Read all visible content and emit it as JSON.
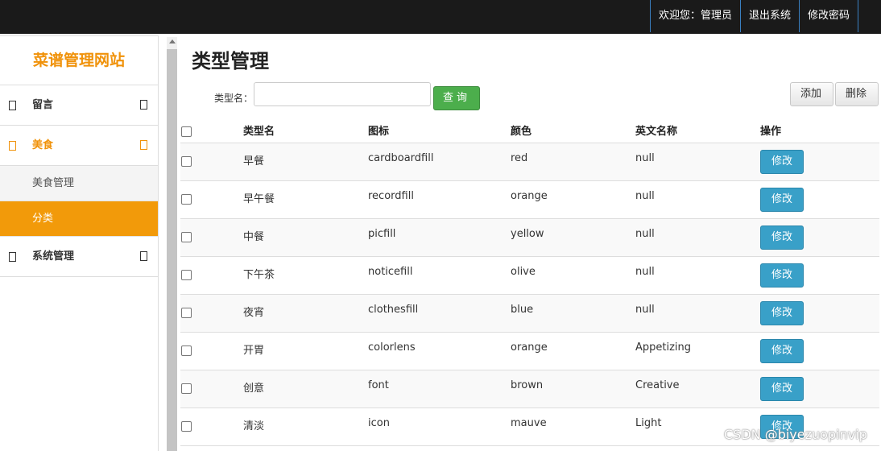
{
  "topbar": {
    "items": [
      "欢迎您：管理员",
      "退出系统",
      "修改密码"
    ]
  },
  "sidebar": {
    "brand": "菜谱管理网站",
    "menus": [
      {
        "label": "留言"
      },
      {
        "label": "美食",
        "active": true,
        "children": [
          "美食管理",
          "分类"
        ]
      },
      {
        "label": "系统管理"
      }
    ]
  },
  "page": {
    "title": "类型管理",
    "search_label": "类型名：",
    "search_value": "",
    "search_button": "查询",
    "add_button": "添加",
    "delete_button": "删除"
  },
  "table": {
    "headers": [
      "类型名",
      "图标",
      "颜色",
      "英文名称",
      "操作"
    ],
    "edit_label": "修改",
    "rows": [
      {
        "name": "早餐",
        "icon": "cardboardfill",
        "color": "red",
        "en": "null"
      },
      {
        "name": "早午餐",
        "icon": "recordfill",
        "color": "orange",
        "en": "null"
      },
      {
        "name": "中餐",
        "icon": "picfill",
        "color": "yellow",
        "en": "null"
      },
      {
        "name": "下午茶",
        "icon": "noticefill",
        "color": "olive",
        "en": "null"
      },
      {
        "name": "夜宵",
        "icon": "clothesfill",
        "color": "blue",
        "en": "null"
      },
      {
        "name": "开胃",
        "icon": "colorlens",
        "color": "orange",
        "en": "Appetizing"
      },
      {
        "name": "创意",
        "icon": "font",
        "color": "brown",
        "en": "Creative"
      },
      {
        "name": "清淡",
        "icon": "icon",
        "color": "mauve",
        "en": "Light"
      }
    ]
  },
  "watermark": "CSDN @biyezuopinvip",
  "colors": {
    "accent": "#f0920a",
    "topbar": "#1a1a1a",
    "search_button": "#4cae4c",
    "edit_button": "#39a0c8"
  }
}
